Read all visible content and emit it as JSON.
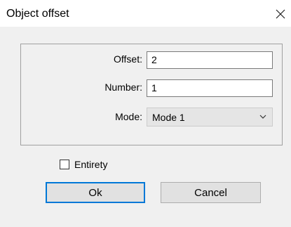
{
  "window": {
    "title": "Object offset",
    "close_glyph": "✕"
  },
  "fields": {
    "offset_label": "Offset:",
    "offset_value": "2",
    "number_label": "Number:",
    "number_value": "1",
    "mode_label": "Mode:",
    "mode_value": "Mode 1"
  },
  "options": {
    "entirety_label": "Entirety",
    "entirety_checked": false
  },
  "buttons": {
    "ok_label": "Ok",
    "cancel_label": "Cancel"
  },
  "icons": {
    "close": "close-icon",
    "dropdown": "chevron-down-icon"
  },
  "colors": {
    "dialog_bg": "#f0f0f0",
    "default_button_border": "#0078d7"
  }
}
